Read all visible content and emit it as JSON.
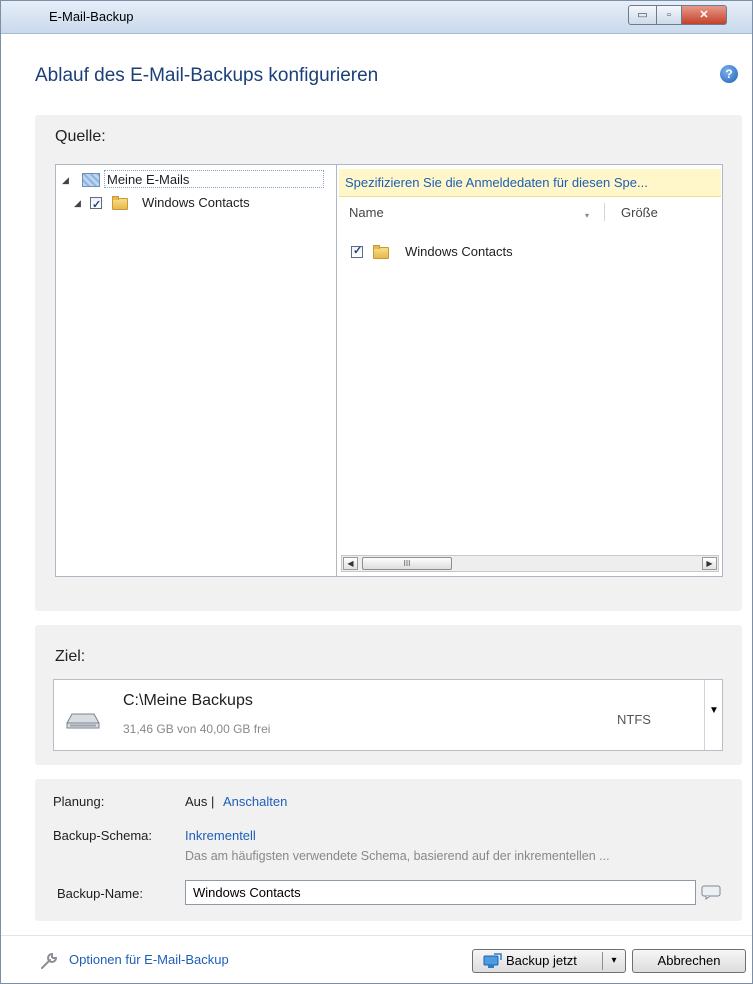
{
  "window": {
    "title": "E-Mail-Backup",
    "controls": {
      "minimize": "▭",
      "maximize": "▫",
      "close": "✕"
    }
  },
  "heading": "Ablauf des E-Mail-Backups konfigurieren",
  "help_icon": "?",
  "source": {
    "label": "Quelle:",
    "tree": [
      {
        "label": "Meine E-Mails",
        "icon": "mail-icon",
        "expanded": true
      },
      {
        "label": "Windows Contacts",
        "icon": "folder-icon",
        "checked": true,
        "expanded": true
      }
    ],
    "notice": "Spezifizieren Sie die Anmeldedaten für diesen Spe...",
    "columns": {
      "name": "Name",
      "size": "Größe"
    },
    "rows": [
      {
        "name": "Windows Contacts",
        "checked": true
      }
    ],
    "scrollbar": {
      "left": "◀",
      "right": "▶",
      "thumb": "III"
    }
  },
  "destination": {
    "label": "Ziel:",
    "path": "C:\\Meine Backups",
    "space": "31,46 GB von 40,00 GB frei",
    "fs": "NTFS",
    "dropdown": "▼"
  },
  "options": {
    "schedule_label": "Planung:",
    "schedule_value": "Aus |",
    "schedule_link": "Anschalten",
    "scheme_label": "Backup-Schema:",
    "scheme_link": "Inkrementell",
    "scheme_desc": "Das am häufigsten verwendete Schema, basierend auf der inkrementellen ...",
    "name_label": "Backup-Name:",
    "name_value": "Windows Contacts"
  },
  "footer": {
    "options_link": "Optionen für E-Mail-Backup",
    "backup_now": "Backup jetzt",
    "split_arrow": "▾",
    "cancel": "Abbrechen"
  },
  "colors": {
    "accent": "#1f5eb8",
    "heading": "#1b3f78",
    "notice_bg": "#fff7c9",
    "panel": "#f1f1f1"
  }
}
